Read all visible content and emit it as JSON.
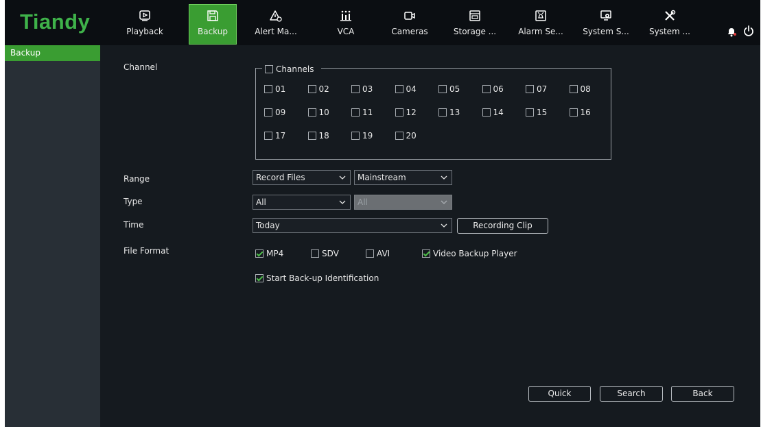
{
  "brand": {
    "logo": "Tiandy",
    "accent": "#3a9d32"
  },
  "nav": [
    {
      "label": "Playback",
      "icon": "playback-icon"
    },
    {
      "label": "Backup",
      "icon": "backup-icon",
      "active": true
    },
    {
      "label": "Alert Ma...",
      "icon": "alert-icon"
    },
    {
      "label": "VCA",
      "icon": "vca-icon"
    },
    {
      "label": "Cameras",
      "icon": "camera-icon"
    },
    {
      "label": "Storage ...",
      "icon": "storage-icon"
    },
    {
      "label": "Alarm Se...",
      "icon": "alarm-icon"
    },
    {
      "label": "System S...",
      "icon": "system-settings-icon"
    },
    {
      "label": "System ...",
      "icon": "tools-icon"
    }
  ],
  "sidebar": {
    "items": [
      {
        "label": "Backup",
        "active": true
      }
    ]
  },
  "form": {
    "channel_label": "Channel",
    "channels_all_label": "Channels",
    "channels": [
      "01",
      "02",
      "03",
      "04",
      "05",
      "06",
      "07",
      "08",
      "09",
      "10",
      "11",
      "12",
      "13",
      "14",
      "15",
      "16",
      "17",
      "18",
      "19",
      "20"
    ],
    "range_label": "Range",
    "range_value": "Record Files",
    "stream_value": "Mainstream",
    "type_label": "Type",
    "type_value": "All",
    "subtype_value": "All",
    "time_label": "Time",
    "time_value": "Today",
    "recording_clip": "Recording Clip",
    "file_format_label": "File Format",
    "formats": [
      {
        "label": "MP4",
        "checked": true
      },
      {
        "label": "SDV",
        "checked": false
      },
      {
        "label": "AVI",
        "checked": false
      },
      {
        "label": "Video Backup Player",
        "checked": true
      }
    ],
    "identification": {
      "label": "Start Back-up Identification",
      "checked": true
    }
  },
  "buttons": {
    "quick": "Quick",
    "search": "Search",
    "back": "Back"
  }
}
